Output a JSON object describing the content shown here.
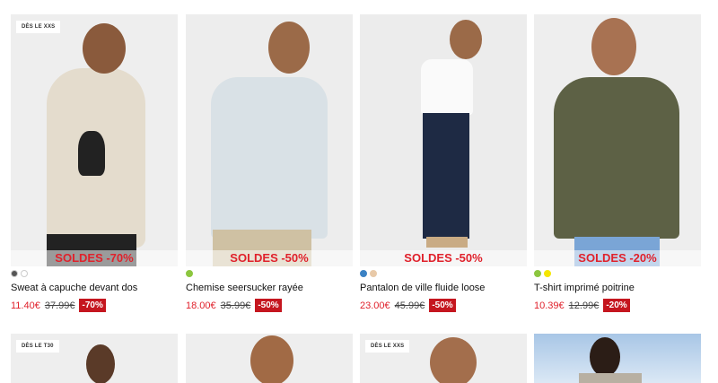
{
  "products": [
    {
      "badge": "DÈS LE XXS",
      "sale": "SOLDES -70%",
      "swatches": [
        "#555555",
        "#ffffff"
      ],
      "title": "Sweat à capuche devant dos",
      "price_new": "11.40€",
      "price_old": "37.99€",
      "discount": "-70%"
    },
    {
      "badge": "",
      "sale": "SOLDES -50%",
      "swatches": [
        "#8cc63f"
      ],
      "title": "Chemise seersucker rayée",
      "price_new": "18.00€",
      "price_old": "35.99€",
      "discount": "-50%"
    },
    {
      "badge": "",
      "sale": "SOLDES -50%",
      "swatches": [
        "#3b82c4",
        "#e8c9a8"
      ],
      "title": "Pantalon de ville fluide loose",
      "price_new": "23.00€",
      "price_old": "45.99€",
      "discount": "-50%"
    },
    {
      "badge": "",
      "sale": "SOLDES -20%",
      "swatches": [
        "#8cc63f",
        "#f5e600"
      ],
      "title": "T-shirt imprimé poitrine",
      "price_new": "10.39€",
      "price_old": "12.99€",
      "discount": "-20%"
    }
  ],
  "row2_badges": [
    "DÈS LE T30",
    "",
    "DÈS LE XXS",
    ""
  ],
  "colors": {
    "sale_red": "#e0212b",
    "discount_bg": "#c5161f"
  }
}
